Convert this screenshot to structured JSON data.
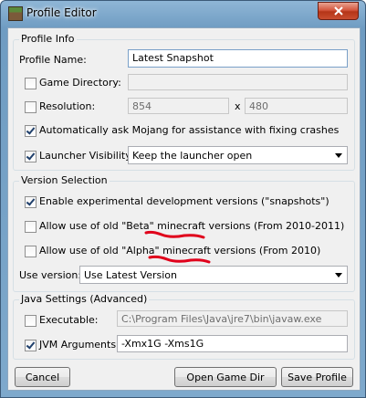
{
  "window": {
    "title": "Profile Editor",
    "app_icon": "minecraft-grass-block-icon",
    "close_icon": "close-icon"
  },
  "profile_info": {
    "group_title": "Profile Info",
    "profile_name_label": "Profile Name:",
    "profile_name_value": "Latest Snapshot",
    "game_directory_label": "Game Directory:",
    "game_directory_checked": false,
    "game_directory_value": "",
    "resolution_label": "Resolution:",
    "resolution_checked": false,
    "resolution_width": "854",
    "resolution_separator": "x",
    "resolution_height": "480",
    "auto_ask_label": "Automatically ask Mojang for assistance with fixing crashes",
    "auto_ask_checked": true,
    "launcher_visibility_label": "Launcher Visibility:",
    "launcher_visibility_checked": true,
    "launcher_visibility_value": "Keep the launcher open"
  },
  "version_selection": {
    "group_title": "Version Selection",
    "snapshots_label": "Enable experimental development versions (\"snapshots\")",
    "snapshots_checked": true,
    "beta_label": "Allow use of old \"Beta\" minecraft versions (From 2010-2011)",
    "beta_checked": false,
    "alpha_label": "Allow use of old \"Alpha\" minecraft versions (From 2010)",
    "alpha_checked": false,
    "use_version_label": "Use version:",
    "use_version_value": "Use Latest Version",
    "annotation_color": "#e0001b"
  },
  "java_settings": {
    "group_title": "Java Settings (Advanced)",
    "executable_label": "Executable:",
    "executable_checked": false,
    "executable_value": "C:\\Program Files\\Java\\jre7\\bin\\javaw.exe",
    "jvm_args_label": "JVM Arguments:",
    "jvm_args_checked": true,
    "jvm_args_value": "-Xmx1G -Xms1G"
  },
  "buttons": {
    "cancel": "Cancel",
    "open_game_dir": "Open Game Dir",
    "save_profile": "Save Profile"
  }
}
